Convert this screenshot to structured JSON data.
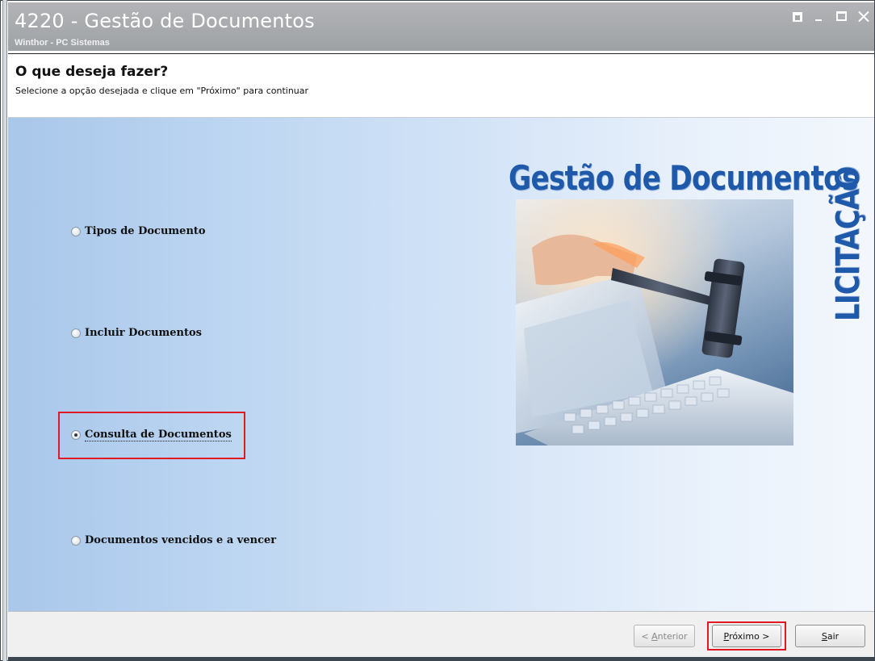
{
  "window": {
    "title": "4220 - Gestão de Documentos",
    "subtitle": "Winthor - PC Sistemas"
  },
  "header": {
    "title": "O que deseja fazer?",
    "instruction": "Selecione a opção desejada e clique em \"Próximo\" para continuar"
  },
  "options": [
    {
      "label": "Tipos de Documento",
      "selected": false
    },
    {
      "label": "Incluir Documentos",
      "selected": false
    },
    {
      "label": "Consulta de Documentos",
      "selected": true
    },
    {
      "label": "Documentos vencidos e a vencer",
      "selected": false
    }
  ],
  "illustration": {
    "title": "Gestão de Documentos",
    "side_text": "LICITAÇÃO",
    "brand_color": "#1f59a9"
  },
  "footer": {
    "prev_accel": "A",
    "prev_rest": "nterior",
    "prev_prefix": "< ",
    "next_accel": "P",
    "next_rest": "róximo >",
    "exit_accel": "S",
    "exit_rest": "air"
  },
  "highlight_color": "#e01a22"
}
